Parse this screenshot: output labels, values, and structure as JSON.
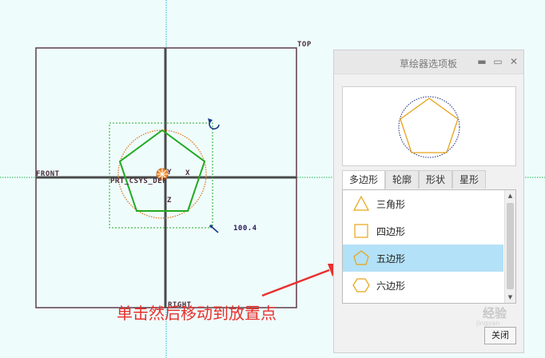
{
  "datums": {
    "top": "TOP",
    "front": "FRONT",
    "right": "RIGHT",
    "csys": "PRT_CSYS_DEF",
    "y_axis": "Y",
    "x_axis": "X",
    "z_axis": "Z"
  },
  "dimension_value": "100.4",
  "annotation": "单击然后移动到放置点",
  "palette": {
    "title": "草绘器选项板",
    "controls": [
      "pin-icon",
      "restore-icon",
      "close-icon"
    ],
    "tabs": [
      {
        "label": "多边形",
        "active": true
      },
      {
        "label": "轮廓",
        "active": false
      },
      {
        "label": "形状",
        "active": false
      },
      {
        "label": "星形",
        "active": false
      }
    ],
    "items": [
      {
        "label": "三角形",
        "icon": "triangle-icon",
        "selected": false
      },
      {
        "label": "四边形",
        "icon": "square-icon",
        "selected": false
      },
      {
        "label": "五边形",
        "icon": "pentagon-icon",
        "selected": true
      },
      {
        "label": "六边形",
        "icon": "hexagon-icon",
        "selected": false
      }
    ],
    "close_label": "关闭"
  },
  "watermark": {
    "line1": "经验",
    "line2": "jingyan"
  },
  "colors": {
    "sketch_green": "#22aa22",
    "orange": "#e07a1f",
    "annotation_red": "#e8302c",
    "selection_blue": "#b3e1f7",
    "shape_icon": "#e8a317"
  }
}
